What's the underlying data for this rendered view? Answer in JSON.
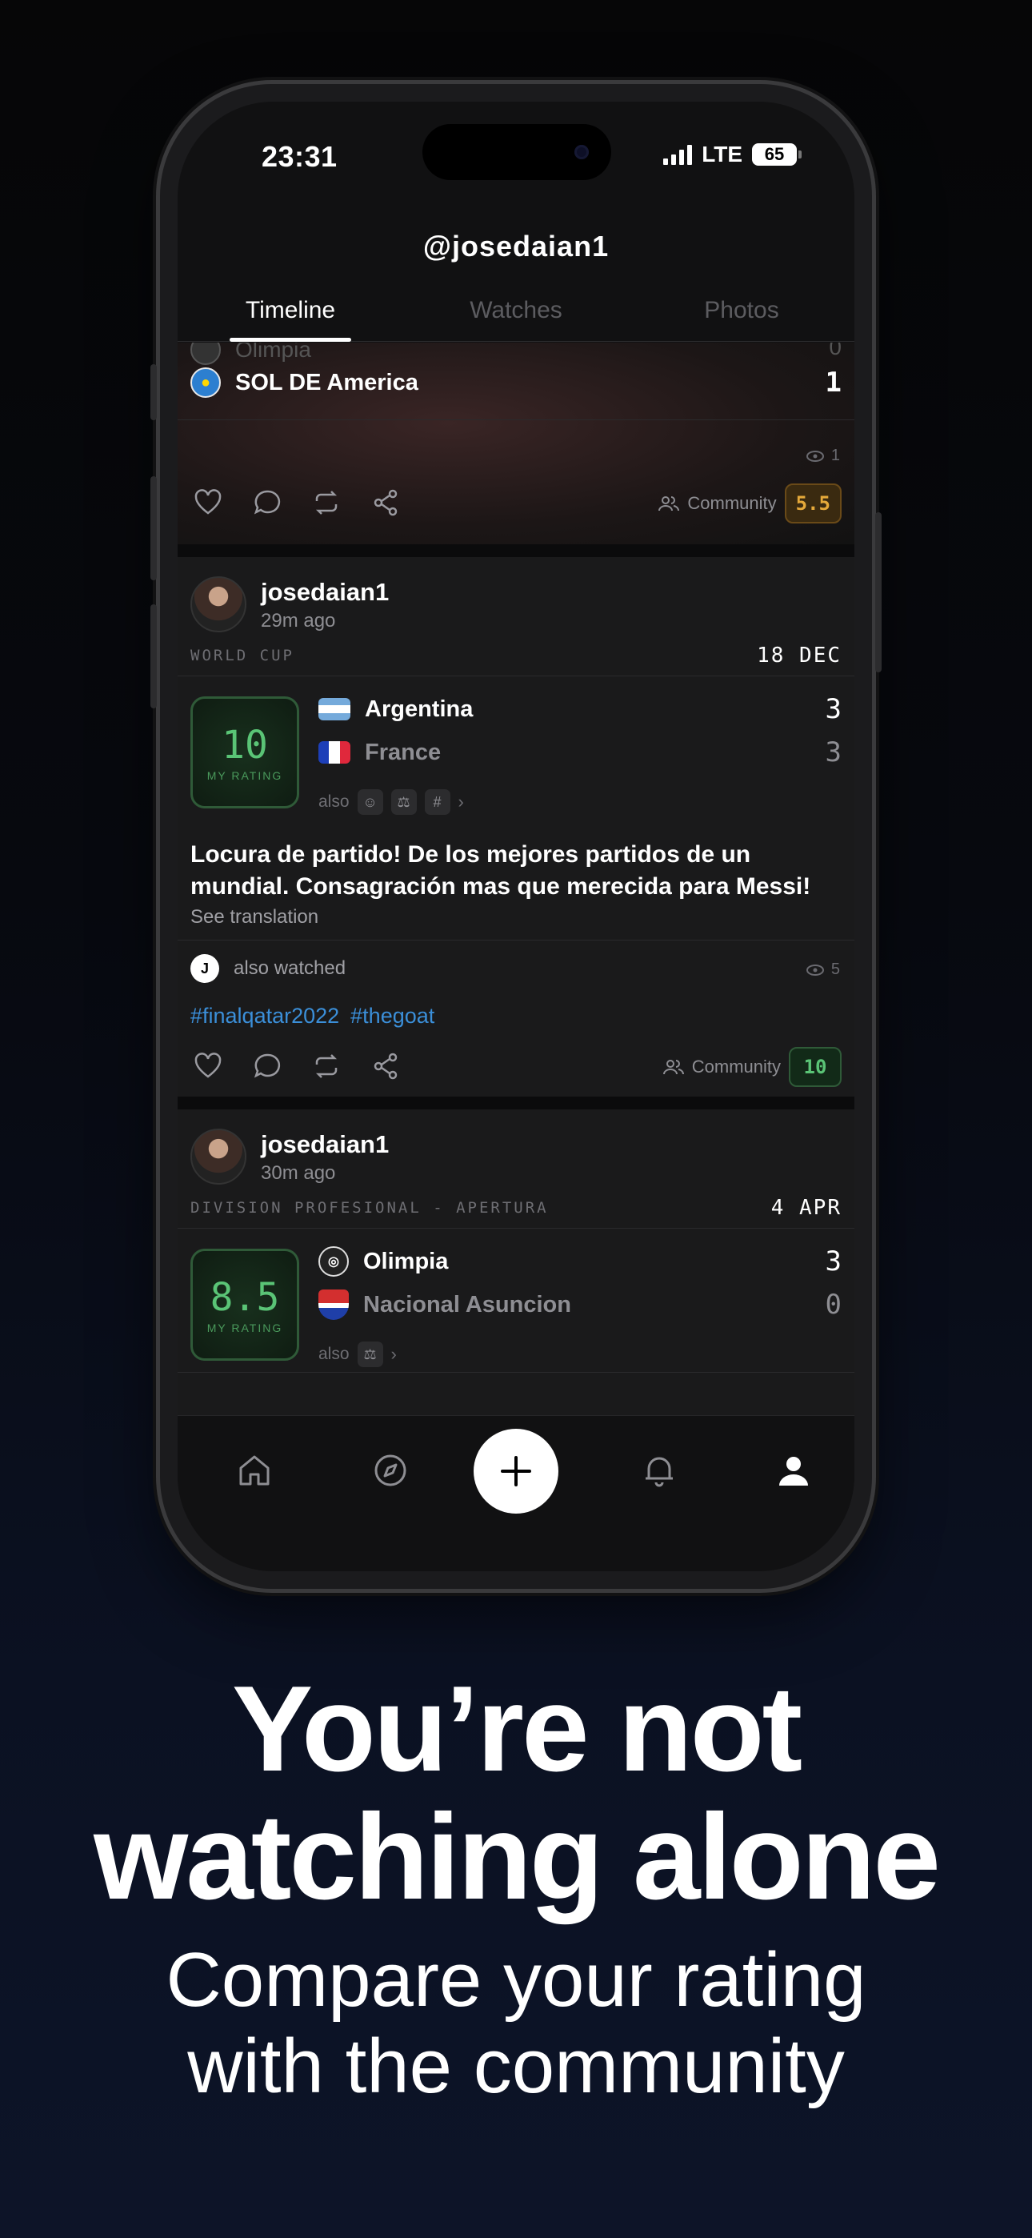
{
  "status_bar": {
    "time": "23:31",
    "network": "LTE",
    "battery": "65"
  },
  "header": {
    "title": "@josedaian1"
  },
  "tabs": [
    {
      "label": "Timeline",
      "active": true
    },
    {
      "label": "Watches",
      "active": false
    },
    {
      "label": "Photos",
      "active": false
    }
  ],
  "card0": {
    "team_home": "Olimpia",
    "team_home_score": "0",
    "team_away": "SOL DE America",
    "team_away_score": "1",
    "views": "1",
    "community_label": "Community",
    "community_rating": "5.5",
    "community_color": "#e5a93a"
  },
  "card1": {
    "user": "josedaian1",
    "ago": "29m ago",
    "competition": "WORLD CUP",
    "date": "18 DEC",
    "rating": "10",
    "rating_label": "MY RATING",
    "home": "Argentina",
    "home_score": "3",
    "away": "France",
    "away_score": "3",
    "also_label": "also",
    "comment": "Locura de partido! De los mejores partidos de un mundial. Consagración mas que merecida para Messi!",
    "translate": "See translation",
    "also_watched_initial": "J",
    "also_watched": "also watched",
    "views": "5",
    "hashtags": [
      "#finalqatar2022",
      "#thegoat"
    ],
    "community_label": "Community",
    "community_rating": "10",
    "community_color": "#5ac476"
  },
  "card2": {
    "user": "josedaian1",
    "ago": "30m ago",
    "competition": "DIVISION PROFESIONAL - APERTURA",
    "date": "4 APR",
    "rating": "8.5",
    "rating_label": "MY RATING",
    "home": "Olimpia",
    "home_score": "3",
    "away": "Nacional Asuncion",
    "away_score": "0",
    "also_label": "also"
  },
  "tabbar": [
    "home-icon",
    "compass-icon",
    "plus-icon",
    "bell-icon",
    "profile-icon"
  ],
  "marketing": {
    "headline_line1": "You’re not",
    "headline_line2": "watching alone",
    "sub_line1": "Compare your rating",
    "sub_line2": "with the community"
  }
}
